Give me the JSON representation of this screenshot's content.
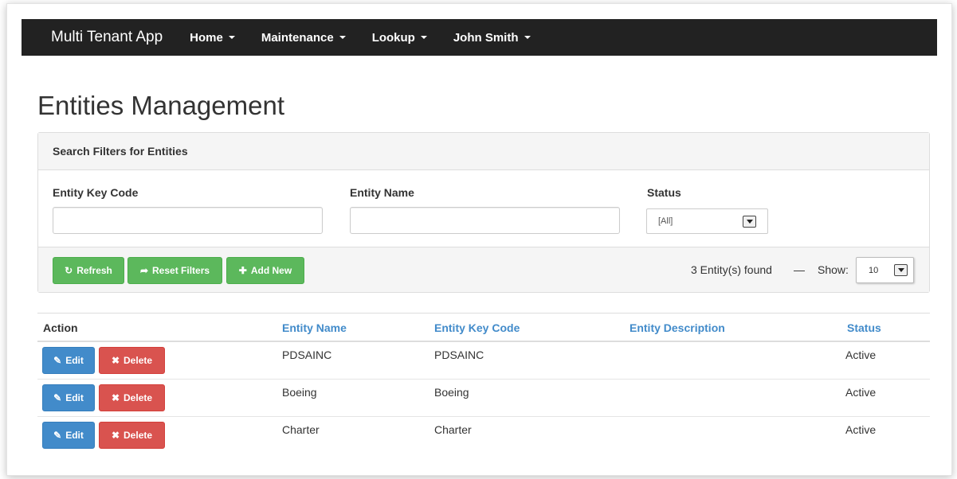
{
  "app": {
    "brand": "Multi Tenant App",
    "menu": [
      {
        "label": "Home"
      },
      {
        "label": "Maintenance"
      },
      {
        "label": "Lookup"
      },
      {
        "label": "John Smith"
      }
    ]
  },
  "page": {
    "title": "Entities Management"
  },
  "filters": {
    "heading": "Search Filters for Entities",
    "entity_key_code_label": "Entity Key Code",
    "entity_key_code_value": "",
    "entity_name_label": "Entity Name",
    "entity_name_value": "",
    "status_label": "Status",
    "status_value": "[All]"
  },
  "toolbar": {
    "refresh_label": "Refresh",
    "reset_label": "Reset Filters",
    "add_label": "Add New",
    "found_text": "3 Entity(s) found",
    "separator": "—",
    "show_label": "Show:",
    "show_value": "10"
  },
  "table": {
    "headers": {
      "action": "Action",
      "entity_name": "Entity Name",
      "entity_key_code": "Entity Key Code",
      "entity_description": "Entity Description",
      "status": "Status"
    },
    "edit_label": "Edit",
    "delete_label": "Delete",
    "rows": [
      {
        "entity_name": "PDSAINC",
        "entity_key_code": "PDSAINC",
        "entity_description": "",
        "status": "Active"
      },
      {
        "entity_name": "Boeing",
        "entity_key_code": "Boeing",
        "entity_description": "",
        "status": "Active"
      },
      {
        "entity_name": "Charter",
        "entity_key_code": "Charter",
        "entity_description": "",
        "status": "Active"
      }
    ]
  },
  "colors": {
    "navbar": "#222222",
    "success": "#5cb85c",
    "primary": "#428bca",
    "danger": "#d9534f"
  },
  "icons": {
    "refresh": "refresh-icon",
    "reset": "share-arrow-icon",
    "add": "plus-icon",
    "edit": "edit-icon",
    "delete": "close-icon",
    "dropdown": "chevron-down-icon"
  }
}
